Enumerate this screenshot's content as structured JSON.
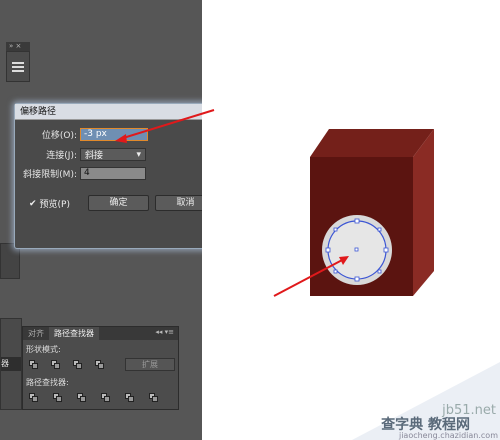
{
  "dialog": {
    "title": "偏移路径",
    "offset_label": "位移(O):",
    "offset_value": "-3 px",
    "join_label": "连接(J):",
    "join_value": "斜接",
    "miter_label": "斜接限制(M):",
    "miter_value": "4",
    "preview_label": "预览(P)",
    "preview_checked": true,
    "ok_label": "确定",
    "cancel_label": "取消"
  },
  "pathfinder_panel": {
    "tabs": [
      "对齐",
      "路径查找器"
    ],
    "shape_modes_label": "形状模式:",
    "pathfinders_label": "路径查找器:",
    "expand_label": "扩展"
  },
  "side_panel": {
    "fragment_label": "器"
  },
  "watermark": {
    "site": "jb51.net",
    "tutorial": "查字典 教程网",
    "url": "jiaocheng.chazidian.com"
  },
  "colors": {
    "workspace": "#565656",
    "box_front": "#5b1410",
    "box_side": "#8a2b24",
    "box_top": "#74201a",
    "circle_outline": "#3b55d4",
    "arrow": "#e0191b"
  }
}
